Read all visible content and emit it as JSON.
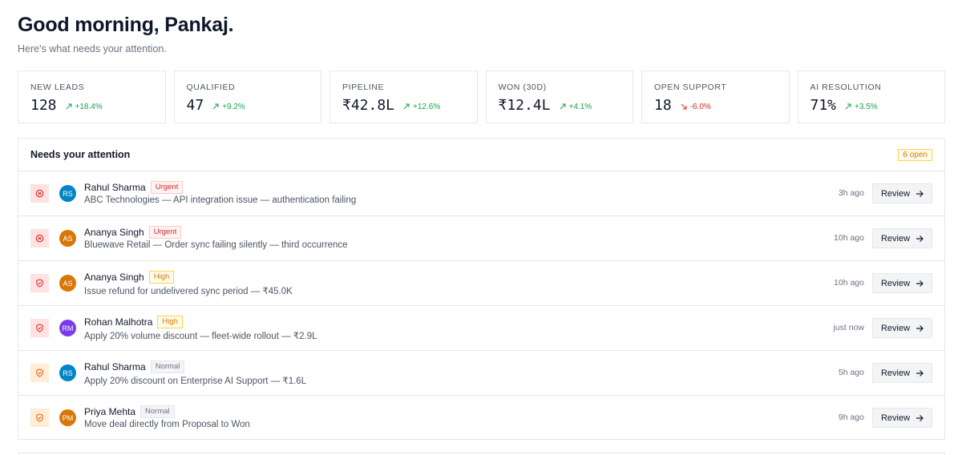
{
  "header": {
    "greeting": "Good morning, Pankaj.",
    "subtitle": "Here's what needs your attention."
  },
  "kpis": [
    {
      "label": "NEW LEADS",
      "value": "128",
      "delta": "+18.4%",
      "direction": "up"
    },
    {
      "label": "QUALIFIED",
      "value": "47",
      "delta": "+9.2%",
      "direction": "up"
    },
    {
      "label": "PIPELINE",
      "value": "₹42.8L",
      "delta": "+12.6%",
      "direction": "up"
    },
    {
      "label": "WON (30D)",
      "value": "₹12.4L",
      "delta": "+4.1%",
      "direction": "up"
    },
    {
      "label": "OPEN SUPPORT",
      "value": "18",
      "delta": "-6.0%",
      "direction": "down"
    },
    {
      "label": "AI RESOLUTION",
      "value": "71%",
      "delta": "+3.5%",
      "direction": "up"
    }
  ],
  "attention": {
    "title": "Needs your attention",
    "open_badge": "6 open",
    "review_label": "Review",
    "items": [
      {
        "icon": "urgent-alert-icon",
        "priority": "urgent",
        "initials": "RS",
        "avatar_color": "#0284c7",
        "name": "Rahul Sharma",
        "tag": "Urgent",
        "description": "ABC Technologies — API integration issue — authentication failing",
        "time": "3h ago"
      },
      {
        "icon": "urgent-alert-icon",
        "priority": "urgent",
        "initials": "AS",
        "avatar_color": "#d97706",
        "name": "Ananya Singh",
        "tag": "Urgent",
        "description": "Bluewave Retail — Order sync failing silently — third occurrence",
        "time": "10h ago"
      },
      {
        "icon": "shield-icon",
        "priority": "high",
        "initials": "AS",
        "avatar_color": "#d97706",
        "name": "Ananya Singh",
        "tag": "High",
        "description": "Issue refund for undelivered sync period — ₹45.0K",
        "time": "10h ago"
      },
      {
        "icon": "shield-icon",
        "priority": "high",
        "initials": "RM",
        "avatar_color": "#7c3aed",
        "name": "Rohan Malhotra",
        "tag": "High",
        "description": "Apply 20% volume discount — fleet-wide rollout — ₹2.9L",
        "time": "just now"
      },
      {
        "icon": "shield-icon",
        "priority": "normal",
        "initials": "RS",
        "avatar_color": "#0284c7",
        "name": "Rahul Sharma",
        "tag": "Normal",
        "description": "Apply 20% discount on Enterprise AI Support — ₹1.6L",
        "time": "5h ago"
      },
      {
        "icon": "shield-icon",
        "priority": "normal",
        "initials": "PM",
        "avatar_color": "#d97706",
        "name": "Priya Mehta",
        "tag": "Normal",
        "description": "Move deal directly from Proposal to Won",
        "time": "9h ago"
      }
    ]
  },
  "colors": {
    "up": "#16a34a",
    "down": "#dc2626",
    "urgent": "#dc2626",
    "high": "#dc2626",
    "normal": "#ea580c"
  }
}
